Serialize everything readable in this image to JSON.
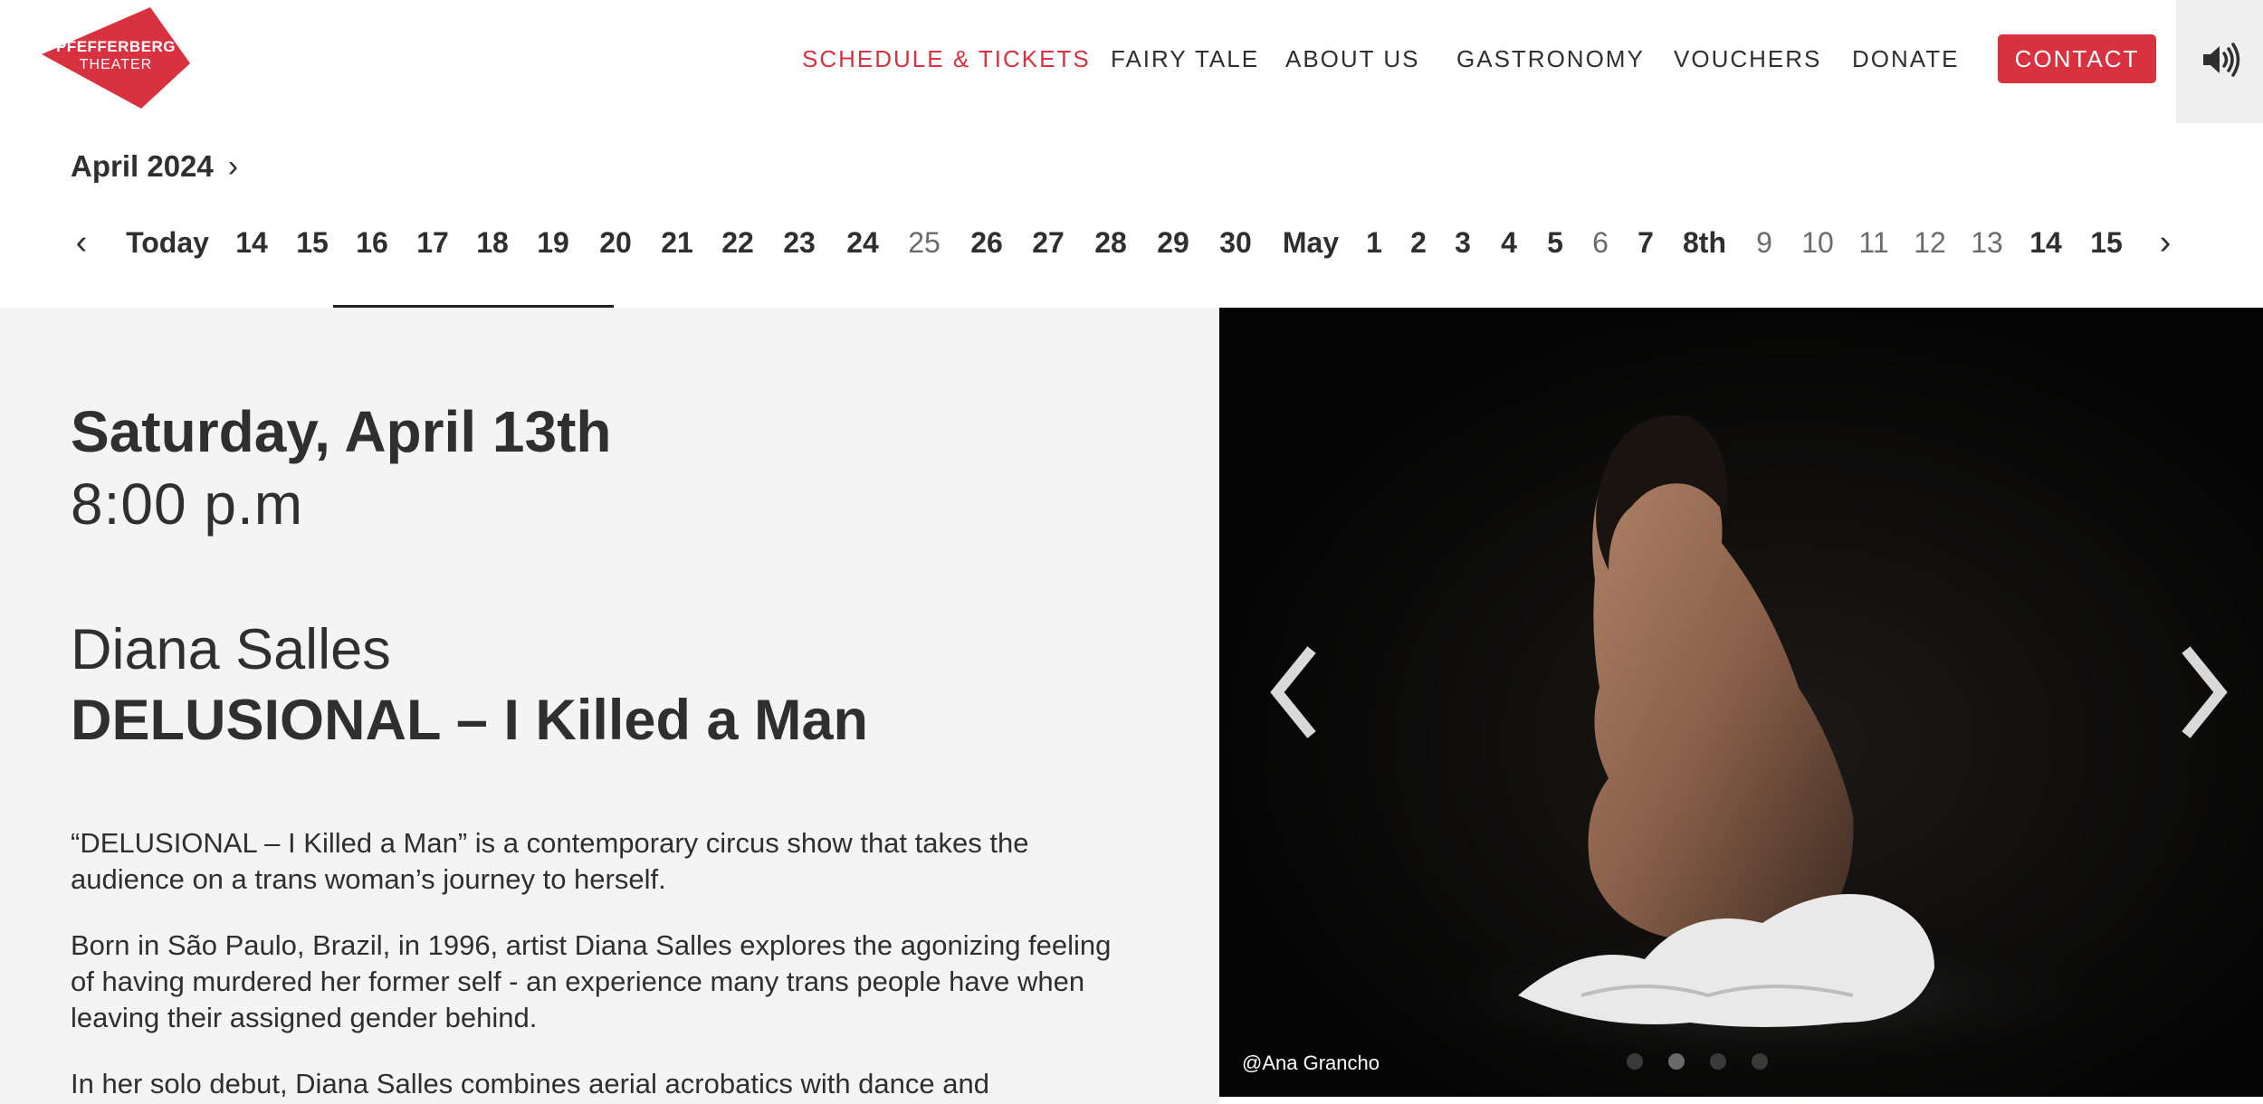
{
  "logo": {
    "line1": "PFEFFERBERG",
    "line2": "THEATER",
    "color": "#d8313f"
  },
  "nav": {
    "items": [
      {
        "label": "SCHEDULE & TICKETS",
        "active": true
      },
      {
        "label": "FAIRY TALE"
      },
      {
        "label": "ABOUT US"
      },
      {
        "label": "GASTRONOMY"
      },
      {
        "label": "VOUCHERS"
      },
      {
        "label": "DONATE"
      }
    ],
    "contact_label": "CONTACT",
    "sound_icon": "speaker-icon",
    "accent": "#d8313f"
  },
  "calendar": {
    "month_label": "April 2024",
    "prev_icon": "chevron-left-icon",
    "next_icon": "chevron-right-icon",
    "days": [
      {
        "label": "Today"
      },
      {
        "label": "14"
      },
      {
        "label": "15"
      },
      {
        "label": "16"
      },
      {
        "label": "17"
      },
      {
        "label": "18"
      },
      {
        "label": "19"
      },
      {
        "label": "20"
      },
      {
        "label": "21"
      },
      {
        "label": "22"
      },
      {
        "label": "23"
      },
      {
        "label": "24"
      },
      {
        "label": "25",
        "available": false
      },
      {
        "label": "26"
      },
      {
        "label": "27"
      },
      {
        "label": "28"
      },
      {
        "label": "29"
      },
      {
        "label": "30"
      },
      {
        "label": "May"
      },
      {
        "label": "1"
      },
      {
        "label": "2"
      },
      {
        "label": "3"
      },
      {
        "label": "4"
      },
      {
        "label": "5"
      },
      {
        "label": "6",
        "available": false
      },
      {
        "label": "7"
      },
      {
        "label": "8th"
      },
      {
        "label": "9",
        "available": false
      },
      {
        "label": "10",
        "available": false
      },
      {
        "label": "11",
        "available": false
      },
      {
        "label": "12",
        "available": false
      },
      {
        "label": "13",
        "available": false
      },
      {
        "label": "14"
      },
      {
        "label": "15"
      }
    ]
  },
  "event": {
    "date": "Saturday, April 13th",
    "time": "8:00 p.m",
    "artist": "Diana Salles",
    "title": "DELUSIONAL – I Killed a Man",
    "paragraphs": [
      "“DELUSIONAL – I Killed a Man” is a contemporary circus show that takes the audience on a trans woman’s journey to herself.",
      "Born in São Paulo, Brazil, in 1996, artist Diana Salles explores the agonizing feeling of having murdered her former self - an experience many trans people have when leaving their assigned gender behind.",
      "In her solo debut, Diana Salles combines aerial acrobatics with dance and"
    ]
  },
  "gallery": {
    "credit": "@Ana Grancho",
    "prev_icon": "chevron-left-icon",
    "next_icon": "chevron-right-icon",
    "slide_count": 4,
    "active_slide": 1
  }
}
